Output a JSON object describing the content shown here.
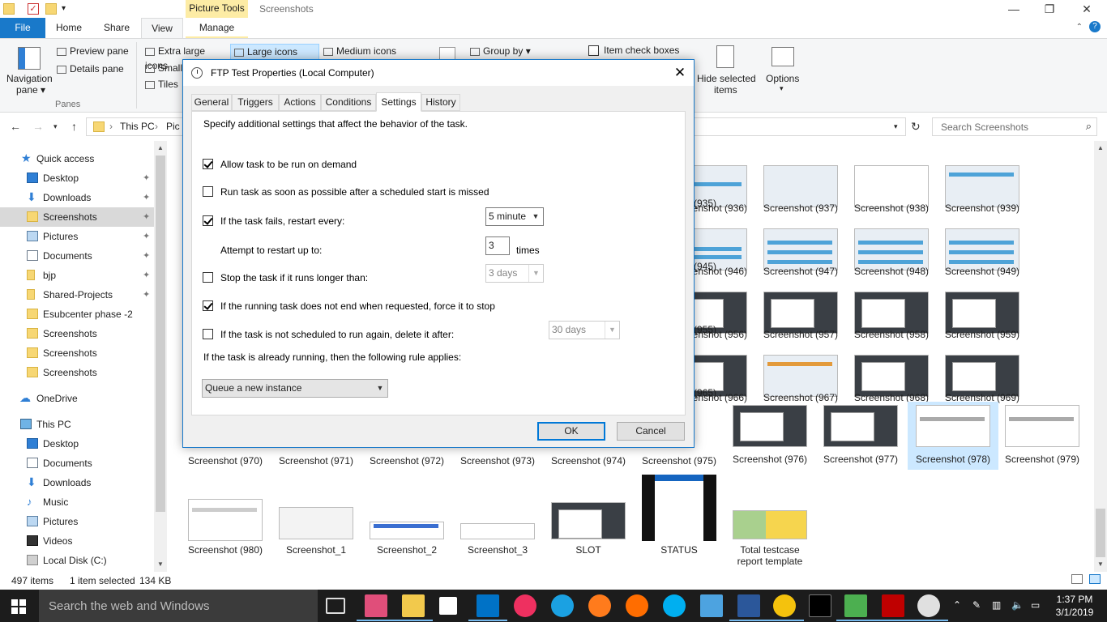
{
  "window": {
    "context_tab": "Picture Tools",
    "title": "Screenshots",
    "min": "—",
    "max": "❐",
    "close": "✕"
  },
  "ribbon_tabs": {
    "file": "File",
    "home": "Home",
    "share": "Share",
    "view": "View",
    "manage": "Manage",
    "help": "?"
  },
  "ribbon": {
    "navigation_pane": "Navigation\npane",
    "navigation_pane_line1": "Navigation",
    "navigation_pane_line2": "pane ▾",
    "preview_pane": "Preview pane",
    "details_pane": "Details pane",
    "panes_group": "Panes",
    "extra_large_icons": "Extra large icons",
    "large_icons": "Large icons",
    "medium_icons": "Medium icons",
    "small": "Small",
    "tiles": "Tiles",
    "group_by": "Group by ▾",
    "item_check_boxes": "Item check boxes",
    "hide_selected_line1": "Hide selected",
    "hide_selected_line2": "items",
    "options": "Options"
  },
  "address": {
    "crumb1": "This PC",
    "crumb2": "Pic",
    "search_placeholder": "Search Screenshots"
  },
  "nav": {
    "quick_access": "Quick access",
    "desktop": "Desktop",
    "downloads": "Downloads",
    "screenshots": "Screenshots",
    "pictures": "Pictures",
    "documents": "Documents",
    "bjp": "bjp",
    "shared_projects": "Shared-Projects",
    "esubcenter": "Esubcenter phase -2",
    "screenshots2": "Screenshots",
    "screenshots3": "Screenshots",
    "screenshots4": "Screenshots",
    "onedrive": "OneDrive",
    "this_pc": "This PC",
    "pc_desktop": "Desktop",
    "pc_documents": "Documents",
    "pc_downloads": "Downloads",
    "pc_music": "Music",
    "pc_pictures": "Pictures",
    "pc_videos": "Videos",
    "pc_disk": "Local Disk (C:)"
  },
  "files": {
    "r1": [
      "(935)",
      "Screenshot (936)",
      "Screenshot (937)",
      "Screenshot (938)",
      "Screenshot (939)"
    ],
    "r2": [
      "(945)",
      "Screenshot (946)",
      "Screenshot (947)",
      "Screenshot (948)",
      "Screenshot (949)"
    ],
    "r3": [
      "(955)",
      "Screenshot (956)",
      "Screenshot (957)",
      "Screenshot (958)",
      "Screenshot (959)"
    ],
    "r4": [
      "(965)",
      "Screenshot (966)",
      "Screenshot (967)",
      "Screenshot (968)",
      "Screenshot (969)"
    ],
    "r5": [
      "Screenshot (970)",
      "Screenshot (971)",
      "Screenshot (972)",
      "Screenshot (973)",
      "Screenshot (974)",
      "Screenshot (975)",
      "Screenshot (976)",
      "Screenshot (977)",
      "Screenshot (978)",
      "Screenshot (979)"
    ],
    "r6": [
      "Screenshot (980)",
      "Screenshot_1",
      "Screenshot_2",
      "Screenshot_3",
      "SLOT",
      "STATUS",
      "Total testcase report template"
    ],
    "total_line1": "Total testcase",
    "total_line2": "report template"
  },
  "status": {
    "count": "497 items",
    "selected": "1 item selected",
    "size": "134 KB"
  },
  "taskbar": {
    "search": "Search the web and Windows",
    "time": "1:37 PM",
    "date": "3/1/2019"
  },
  "dialog": {
    "title": "FTP Test Properties (Local Computer)",
    "close": "✕",
    "tabs": [
      "General",
      "Triggers",
      "Actions",
      "Conditions",
      "Settings",
      "History"
    ],
    "intro": "Specify additional settings that affect the behavior of the task.",
    "opt_run_on_demand": "Allow task to be run on demand",
    "opt_run_asap": "Run task as soon as possible after a scheduled start is missed",
    "opt_restart": "If the task fails, restart every:",
    "restart_interval": "5 minute",
    "attempt_label": "Attempt to restart up to:",
    "attempt_value": "3",
    "attempt_unit": "times",
    "opt_stop_longer": "Stop the task if it runs longer than:",
    "stop_duration": "3 days",
    "opt_force_stop": "If the running task does not end when requested, force it to stop",
    "opt_delete": "If the task is not scheduled to run again, delete it after:",
    "delete_after": "30 days",
    "rule_label": "If the task is already running, then the following rule applies:",
    "rule_value": "Queue a new instance",
    "ok": "OK",
    "cancel": "Cancel",
    "checked": {
      "run_on_demand": true,
      "run_asap": false,
      "restart": true,
      "stop_longer": false,
      "force_stop": true,
      "delete": false
    }
  },
  "colors": {
    "accent": "#1979ca",
    "selection": "#cce8ff",
    "taskbar": "#1c1c1c"
  }
}
